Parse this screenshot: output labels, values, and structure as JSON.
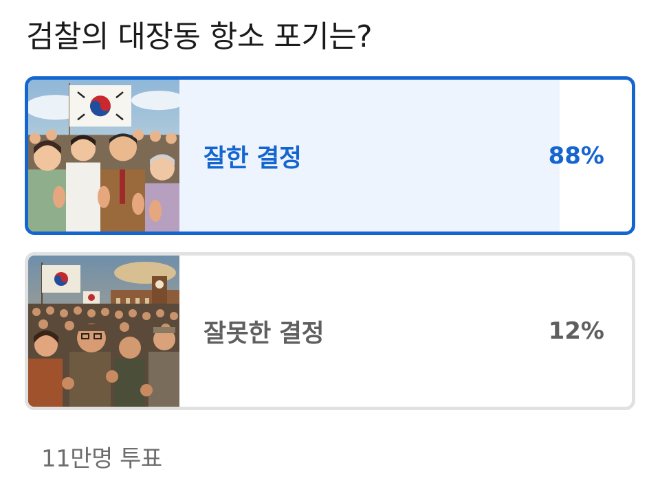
{
  "poll": {
    "question": "검찰의 대장동 항소 포기는?",
    "options": [
      {
        "label": "잘한 결정",
        "percent_text": "88%",
        "percent": 88,
        "selected": true,
        "thumbnail": "celebrating-crowd-with-korean-flag-image"
      },
      {
        "label": "잘못한 결정",
        "percent_text": "12%",
        "percent": 12,
        "selected": false,
        "thumbnail": "angry-protest-crowd-with-korean-flags-image"
      }
    ],
    "vote_count": "11만명 투표"
  },
  "colors": {
    "accent": "#1565d0",
    "selected_fill": "#edf4fe",
    "unselected_fill": "#e6e6e6",
    "unselected_border": "#e1e1e1",
    "muted_text": "#6d6d6d"
  }
}
